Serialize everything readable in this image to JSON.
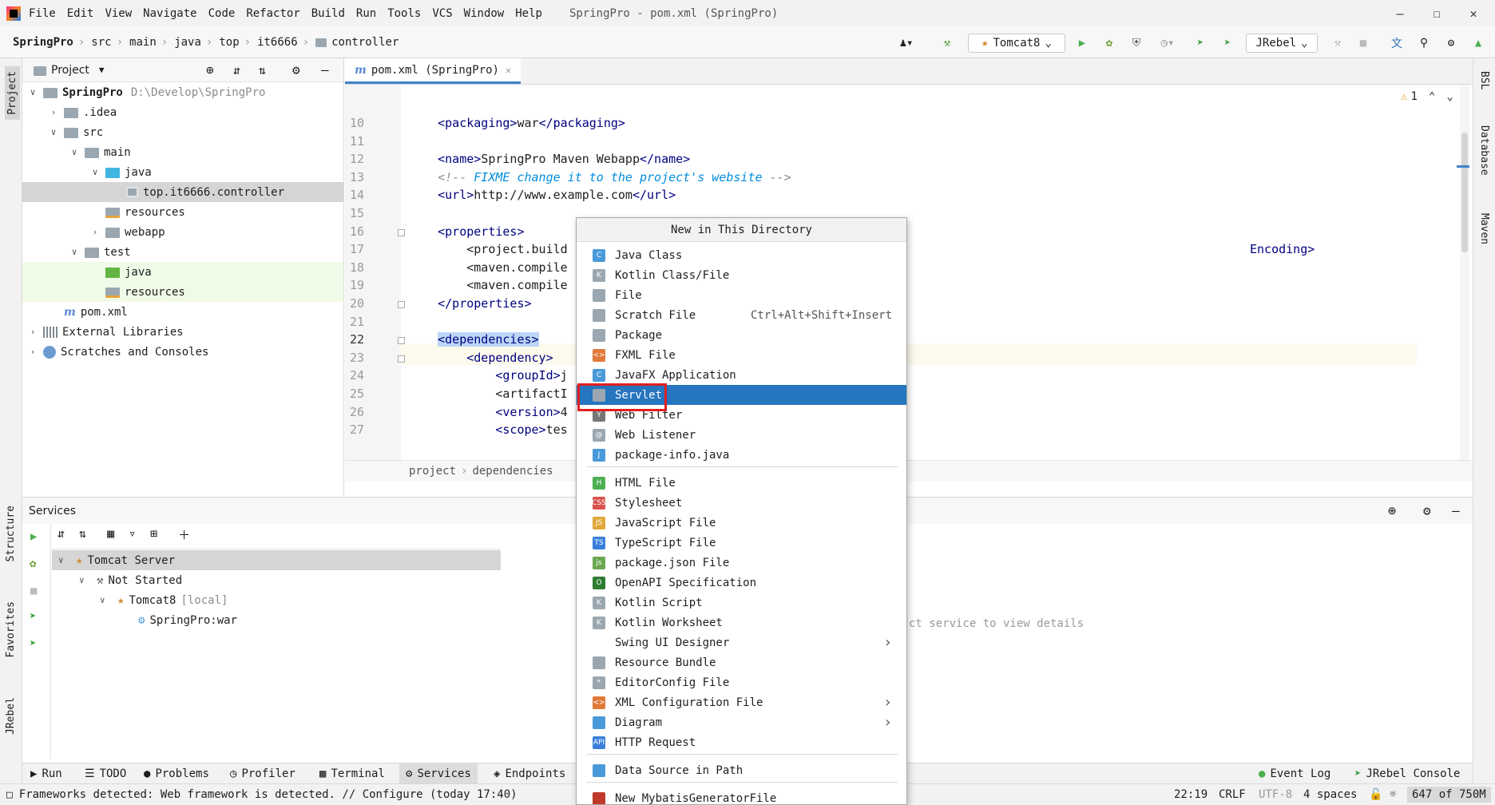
{
  "menubar": {
    "items": [
      "File",
      "Edit",
      "View",
      "Navigate",
      "Code",
      "Refactor",
      "Build",
      "Run",
      "Tools",
      "VCS",
      "Window",
      "Help"
    ],
    "title": "SpringPro - pom.xml (SpringPro)"
  },
  "navbar": {
    "crumbs": [
      "SpringPro",
      "src",
      "main",
      "java",
      "top",
      "it6666",
      "controller"
    ],
    "run_config": "Tomcat8",
    "jrebel": "JRebel"
  },
  "left_strip": [
    "Project",
    "Structure",
    "Favorites",
    "JRebel"
  ],
  "right_strip": [
    "BSL",
    "Database",
    "Maven"
  ],
  "project": {
    "title": "Project",
    "tree": [
      {
        "label": "SpringPro",
        "extra": "D:\\Develop\\SpringPro",
        "depth": 0,
        "arrow": "v",
        "icon": "folder"
      },
      {
        "label": ".idea",
        "extra": "",
        "depth": 1,
        "arrow": ">",
        "icon": "folder"
      },
      {
        "label": "src",
        "extra": "",
        "depth": 1,
        "arrow": "v",
        "icon": "folder"
      },
      {
        "label": "main",
        "extra": "",
        "depth": 2,
        "arrow": "v",
        "icon": "folder"
      },
      {
        "label": "java",
        "extra": "",
        "depth": 3,
        "arrow": "v",
        "icon": "blue"
      },
      {
        "label": "top.it6666.controller",
        "extra": "",
        "depth": 4,
        "arrow": "",
        "icon": "pkg"
      },
      {
        "label": "resources",
        "extra": "",
        "depth": 3,
        "arrow": "",
        "icon": "res"
      },
      {
        "label": "webapp",
        "extra": "",
        "depth": 3,
        "arrow": ">",
        "icon": "folder"
      },
      {
        "label": "test",
        "extra": "",
        "depth": 2,
        "arrow": "v",
        "icon": "folder"
      },
      {
        "label": "java",
        "extra": "",
        "depth": 3,
        "arrow": "",
        "icon": "green"
      },
      {
        "label": "resources",
        "extra": "",
        "depth": 3,
        "arrow": "",
        "icon": "res"
      },
      {
        "label": "pom.xml",
        "extra": "",
        "depth": 1,
        "arrow": "",
        "icon": "mvn"
      },
      {
        "label": "External Libraries",
        "extra": "",
        "depth": 0,
        "arrow": ">",
        "icon": "libs"
      },
      {
        "label": "Scratches and Consoles",
        "extra": "",
        "depth": 0,
        "arrow": ">",
        "icon": "scr"
      }
    ]
  },
  "editor": {
    "tab": "pom.xml (SpringPro)",
    "warnings": "1",
    "breadcrumb": [
      "project",
      "dependencies"
    ],
    "lines": [
      {
        "n": "10",
        "code": "    <packaging>war</packaging>"
      },
      {
        "n": "11",
        "code": ""
      },
      {
        "n": "12",
        "code": "    <name>SpringPro Maven Webapp</name>"
      },
      {
        "n": "13",
        "code": "    <!-- FIXME change it to the project's website -->"
      },
      {
        "n": "14",
        "code": "    <url>http://www.example.com</url>"
      },
      {
        "n": "15",
        "code": ""
      },
      {
        "n": "16",
        "code": "    <properties>"
      },
      {
        "n": "17",
        "code": "        <project.build"
      },
      {
        "n": "18",
        "code": "        <maven.compile"
      },
      {
        "n": "19",
        "code": "        <maven.compile"
      },
      {
        "n": "20",
        "code": "    </properties>"
      },
      {
        "n": "21",
        "code": ""
      },
      {
        "n": "22",
        "code": "    <dependencies>"
      },
      {
        "n": "23",
        "code": "        <dependency>"
      },
      {
        "n": "24",
        "code": "            <groupId>j"
      },
      {
        "n": "25",
        "code": "            <artifactI"
      },
      {
        "n": "26",
        "code": "            <version>4"
      },
      {
        "n": "27",
        "code": "            <scope>tes"
      }
    ],
    "line17_tail": "Encoding>"
  },
  "popup": {
    "title": "New in This Directory",
    "items": [
      {
        "label": "Java Class",
        "shortcut": "",
        "submenu": false,
        "color": "#4a9ad9",
        "glyph": "C",
        "sep_before": false
      },
      {
        "label": "Kotlin Class/File",
        "shortcut": "",
        "submenu": false,
        "color": "#9aa7b0",
        "glyph": "K",
        "sep_before": false
      },
      {
        "label": "File",
        "shortcut": "",
        "submenu": false,
        "color": "#9aa7b0",
        "glyph": "",
        "sep_before": false
      },
      {
        "label": "Scratch File",
        "shortcut": "Ctrl+Alt+Shift+Insert",
        "submenu": false,
        "color": "#9aa7b0",
        "glyph": "",
        "sep_before": false
      },
      {
        "label": "Package",
        "shortcut": "",
        "submenu": false,
        "color": "#9aa7b0",
        "glyph": "",
        "sep_before": false
      },
      {
        "label": "FXML File",
        "shortcut": "",
        "submenu": false,
        "color": "#e07a3a",
        "glyph": "<>",
        "sep_before": false
      },
      {
        "label": "JavaFX Application",
        "shortcut": "",
        "submenu": false,
        "color": "#4a9ad9",
        "glyph": "C",
        "sep_before": false
      },
      {
        "label": "Servlet",
        "shortcut": "",
        "submenu": false,
        "color": "#9aa7b0",
        "glyph": "",
        "sep_before": false
      },
      {
        "label": "Web Filter",
        "shortcut": "",
        "submenu": false,
        "color": "#777777",
        "glyph": "Y",
        "sep_before": false
      },
      {
        "label": "Web Listener",
        "shortcut": "",
        "submenu": false,
        "color": "#9aa7b0",
        "glyph": "@",
        "sep_before": false
      },
      {
        "label": "package-info.java",
        "shortcut": "",
        "submenu": false,
        "color": "#4a9ad9",
        "glyph": "J",
        "sep_before": false
      },
      {
        "label": "HTML File",
        "shortcut": "",
        "submenu": false,
        "color": "#4caf50",
        "glyph": "H",
        "sep_before": true
      },
      {
        "label": "Stylesheet",
        "shortcut": "",
        "submenu": false,
        "color": "#d9534f",
        "glyph": "CSS",
        "sep_before": false
      },
      {
        "label": "JavaScript File",
        "shortcut": "",
        "submenu": false,
        "color": "#e0a83a",
        "glyph": "JS",
        "sep_before": false
      },
      {
        "label": "TypeScript File",
        "shortcut": "",
        "submenu": false,
        "color": "#3a7fd9",
        "glyph": "TS",
        "sep_before": false
      },
      {
        "label": "package.json File",
        "shortcut": "",
        "submenu": false,
        "color": "#6aa84f",
        "glyph": "js",
        "sep_before": false
      },
      {
        "label": "OpenAPI Specification",
        "shortcut": "",
        "submenu": false,
        "color": "#2e7d32",
        "glyph": "O",
        "sep_before": false
      },
      {
        "label": "Kotlin Script",
        "shortcut": "",
        "submenu": false,
        "color": "#9aa7b0",
        "glyph": "K",
        "sep_before": false
      },
      {
        "label": "Kotlin Worksheet",
        "shortcut": "",
        "submenu": false,
        "color": "#9aa7b0",
        "glyph": "K",
        "sep_before": false
      },
      {
        "label": "Swing UI Designer",
        "shortcut": "",
        "submenu": true,
        "color": "",
        "glyph": "",
        "sep_before": false
      },
      {
        "label": "Resource Bundle",
        "shortcut": "",
        "submenu": false,
        "color": "#9aa7b0",
        "glyph": "",
        "sep_before": false
      },
      {
        "label": "EditorConfig File",
        "shortcut": "",
        "submenu": false,
        "color": "#9aa7b0",
        "glyph": "*",
        "sep_before": false
      },
      {
        "label": "XML Configuration File",
        "shortcut": "",
        "submenu": true,
        "color": "#e07a3a",
        "glyph": "<>",
        "sep_before": false
      },
      {
        "label": "Diagram",
        "shortcut": "",
        "submenu": true,
        "color": "#4a9ad9",
        "glyph": "",
        "sep_before": false
      },
      {
        "label": "HTTP Request",
        "shortcut": "",
        "submenu": false,
        "color": "#3a7fd9",
        "glyph": "API",
        "sep_before": false
      },
      {
        "label": "Data Source in Path",
        "shortcut": "",
        "submenu": false,
        "color": "#4a9ad9",
        "glyph": "",
        "sep_before": true
      },
      {
        "label": "New MybatisGeneratorFile",
        "shortcut": "",
        "submenu": false,
        "color": "#c0392b",
        "glyph": "",
        "sep_before": true
      }
    ],
    "selected": "Servlet"
  },
  "services": {
    "title": "Services",
    "tree": [
      {
        "label": "Tomcat Server",
        "extra": "",
        "depth": 0,
        "arrow": "v"
      },
      {
        "label": "Not Started",
        "extra": "",
        "depth": 1,
        "arrow": "v"
      },
      {
        "label": "Tomcat8",
        "extra": "[local]",
        "depth": 2,
        "arrow": "v"
      },
      {
        "label": "SpringPro:war",
        "extra": "",
        "depth": 3,
        "arrow": ""
      }
    ],
    "hint": "ct service to view details"
  },
  "bottom_tabs": [
    "Run",
    "TODO",
    "Problems",
    "Profiler",
    "Terminal",
    "Services",
    "Endpoints"
  ],
  "bottom_right": [
    "Event Log",
    "JRebel Console"
  ],
  "status": {
    "message": "Frameworks detected: Web framework is detected. // Configure (today 17:40)",
    "position": "22:19",
    "line_sep": "CRLF",
    "encoding": "UTF-8",
    "indent": "4 spaces",
    "memory": "647 of 750M"
  }
}
